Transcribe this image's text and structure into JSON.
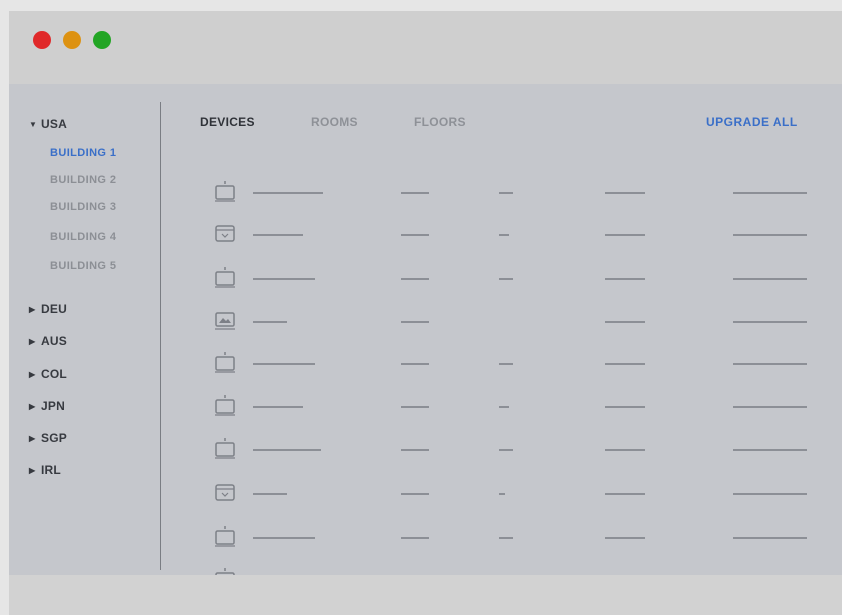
{
  "window": {
    "controls": [
      "close",
      "minimize",
      "maximize"
    ]
  },
  "colors": {
    "accent": "#3a6fc8",
    "close": "#e0292a",
    "minimize": "#dd9212",
    "maximize": "#22a524"
  },
  "sidebar": {
    "expanded": {
      "label": "USA",
      "arrow": "▼"
    },
    "buildings": [
      {
        "label": "BUILDING 1",
        "active": true
      },
      {
        "label": "BUILDING 2",
        "active": false
      },
      {
        "label": "BUILDING 3",
        "active": false
      },
      {
        "label": "BUILDING 4",
        "active": false
      },
      {
        "label": "BUILDING 5",
        "active": false
      }
    ],
    "collapsed": [
      {
        "label": "DEU",
        "arrow": "▶"
      },
      {
        "label": "AUS",
        "arrow": "▶"
      },
      {
        "label": "COL",
        "arrow": "▶"
      },
      {
        "label": "JPN",
        "arrow": "▶"
      },
      {
        "label": "SGP",
        "arrow": "▶"
      },
      {
        "label": "IRL",
        "arrow": "▶"
      }
    ]
  },
  "tabs": [
    {
      "label": "DEVICES",
      "active": true
    },
    {
      "label": "ROOMS",
      "active": false
    },
    {
      "label": "FLOORS",
      "active": false
    }
  ],
  "upgrade_label": "UPGRADE ALL",
  "device_rows": [
    {
      "icon": "access-point-icon"
    },
    {
      "icon": "router-icon"
    },
    {
      "icon": "access-point-icon"
    },
    {
      "icon": "camera-icon"
    },
    {
      "icon": "access-point-icon"
    },
    {
      "icon": "access-point-icon"
    },
    {
      "icon": "access-point-icon"
    },
    {
      "icon": "router-icon"
    },
    {
      "icon": "access-point-icon"
    },
    {
      "icon": "access-point-icon"
    }
  ]
}
